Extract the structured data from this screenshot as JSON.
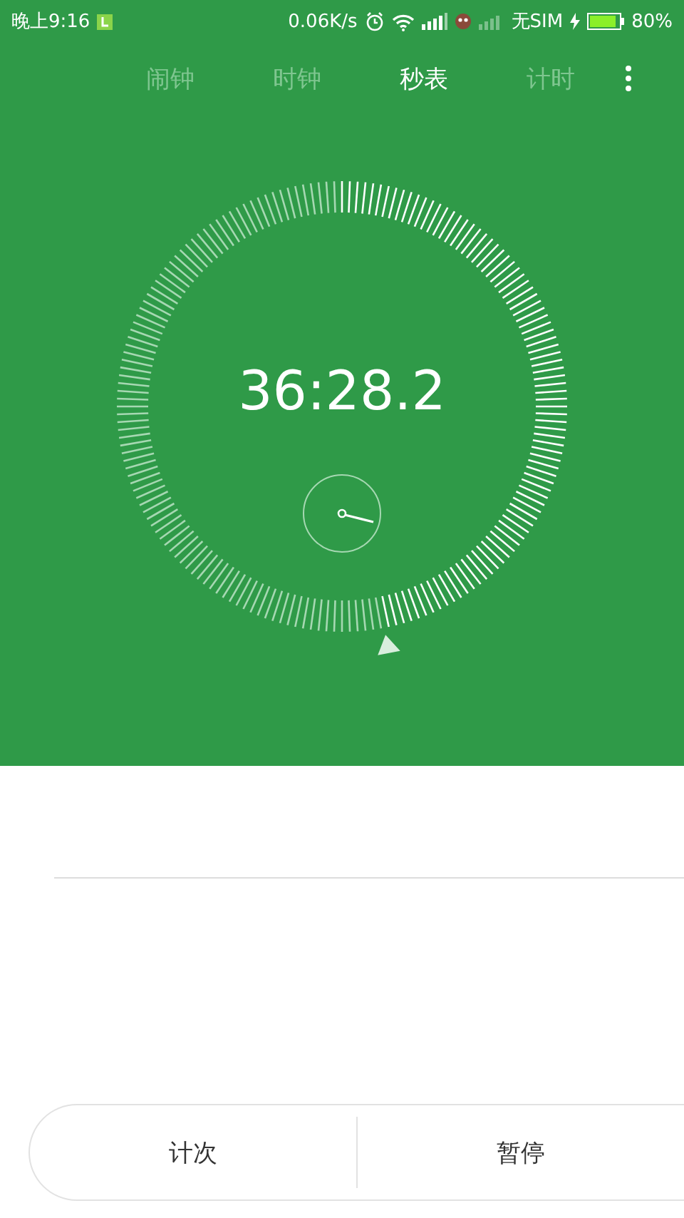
{
  "status_bar": {
    "time": "晚上9:16",
    "speed": "0.06K/s",
    "sim": "无SIM",
    "battery": "80%"
  },
  "tabs": [
    {
      "label": "闹钟",
      "selected": false
    },
    {
      "label": "时钟",
      "selected": false
    },
    {
      "label": "秒表",
      "selected": true
    },
    {
      "label": "计时",
      "selected": false
    }
  ],
  "stopwatch": {
    "reading": "36:28.2"
  },
  "buttons": [
    {
      "label": "计次"
    },
    {
      "label": "暂停"
    }
  ]
}
